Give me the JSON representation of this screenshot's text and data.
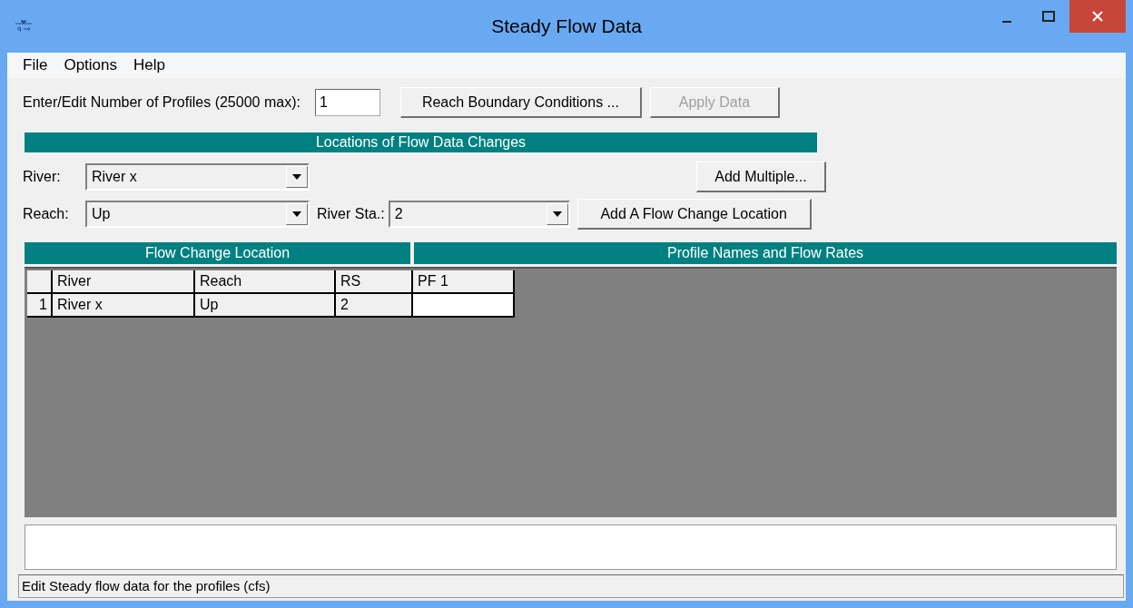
{
  "window": {
    "title": "Steady Flow Data"
  },
  "menu": [
    "File",
    "Options",
    "Help"
  ],
  "profiles": {
    "label": "Enter/Edit Number of Profiles (25000 max):",
    "value": "1"
  },
  "top_buttons": [
    {
      "label": "Reach Boundary Conditions ...",
      "disabled": false
    },
    {
      "label": "Apply Data",
      "disabled": true
    }
  ],
  "locations": {
    "title": "Locations of Flow Data Changes",
    "river": {
      "label": "River:",
      "value": "River x"
    },
    "reach": {
      "label": "Reach:",
      "value": "Up"
    },
    "river_sta": {
      "label": "River Sta.:",
      "value": "2"
    },
    "add_multiple": {
      "label": "Add Multiple...",
      "disabled": false
    },
    "add_location": {
      "label": "Add A Flow Change Location",
      "disabled": false
    }
  },
  "grid": {
    "left_title": "Flow Change Location",
    "right_title": "Profile Names and Flow Rates",
    "columns": [
      "River",
      "Reach",
      "RS",
      "PF 1"
    ],
    "rows": [
      {
        "number": "1",
        "cells": [
          "River x",
          "Up",
          "2",
          ""
        ]
      }
    ]
  },
  "status_bar": "Edit Steady flow data for the profiles (cfs)"
}
